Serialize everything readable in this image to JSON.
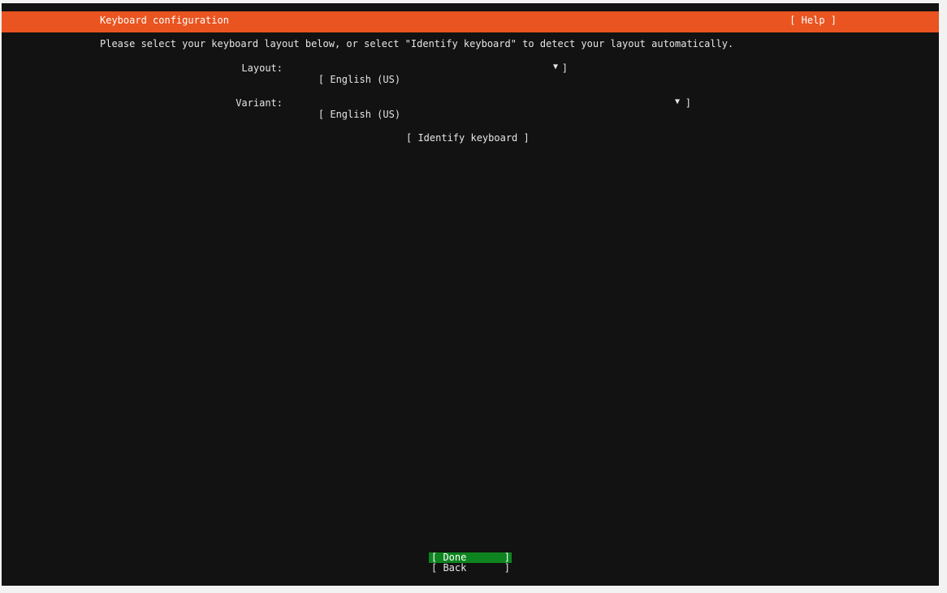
{
  "header": {
    "title": "Keyboard configuration",
    "help_label": "[ Help ]"
  },
  "main": {
    "instructions": "Please select your keyboard layout below, or select \"Identify keyboard\" to detect your layout automatically.",
    "layout": {
      "label": "Layout:",
      "value": "[ English (US)",
      "arrow": "▼",
      "close_bracket": "]"
    },
    "variant": {
      "label": "Variant:",
      "value": "[ English (US)",
      "arrow": "▼",
      "close_bracket": "]"
    },
    "identify_label": "[ Identify keyboard ]"
  },
  "footer": {
    "done_label": "[ Done",
    "back_label": "[ Back",
    "close_bracket": "]"
  },
  "colors": {
    "accent": "#e95420",
    "background": "#121212",
    "done_highlight": "#0e8420"
  }
}
